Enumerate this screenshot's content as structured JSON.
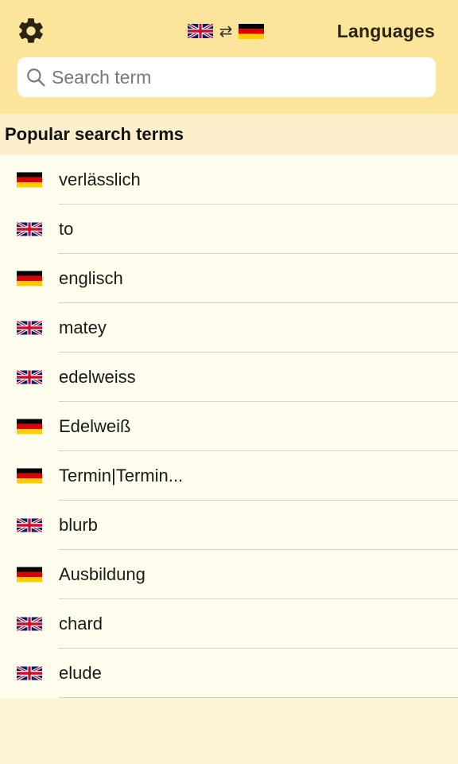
{
  "header": {
    "settings_icon": "gear-icon",
    "source_language": "English",
    "source_flag": "uk-flag-icon",
    "swap_icon": "swap-arrows-icon",
    "swap_glyph": "⇄",
    "target_language": "German",
    "target_flag": "german-flag-icon",
    "languages_label": "Languages",
    "background_color": "#fbe59a"
  },
  "search": {
    "placeholder": "Search term",
    "value": "",
    "icon": "search-icon"
  },
  "section": {
    "title": "Popular search terms"
  },
  "terms": [
    {
      "lang": "de",
      "text": "verlässlich"
    },
    {
      "lang": "en",
      "text": "to"
    },
    {
      "lang": "de",
      "text": "englisch"
    },
    {
      "lang": "en",
      "text": "matey"
    },
    {
      "lang": "en",
      "text": "edelweiss"
    },
    {
      "lang": "de",
      "text": "Edelweiß"
    },
    {
      "lang": "de",
      "text": "Termin|Termin..."
    },
    {
      "lang": "en",
      "text": "blurb"
    },
    {
      "lang": "de",
      "text": "Ausbildung"
    },
    {
      "lang": "en",
      "text": "chard"
    },
    {
      "lang": "en",
      "text": "elude"
    }
  ]
}
